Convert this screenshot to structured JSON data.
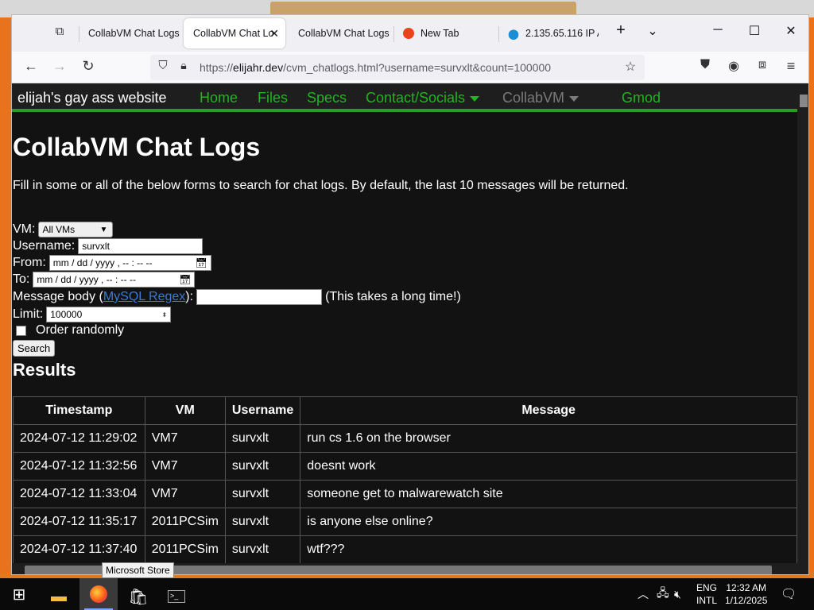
{
  "browser": {
    "tabs": [
      {
        "label": "CollabVM Chat Logs"
      },
      {
        "label": "CollabVM Chat Lo",
        "active": true
      },
      {
        "label": "CollabVM Chat Logs"
      },
      {
        "label": "New Tab"
      },
      {
        "label": "2.135.65.116 IP A"
      }
    ],
    "url_prefix": "https://",
    "url_domain": "elijahr.dev",
    "url_path": "/cvm_chatlogs.html?username=survxlt&count=100000"
  },
  "site": {
    "brand": "elijah's gay ass website",
    "nav": [
      "Home",
      "Files",
      "Specs",
      "Contact/Socials",
      "CollabVM",
      "Gmod"
    ],
    "accent": "#22b422"
  },
  "page": {
    "title": "CollabVM Chat Logs",
    "intro": "Fill in some or all of the below forms to search for chat logs. By default, the last 10 messages will be returned.",
    "vm_label": "VM:",
    "vm_selected": "All VMs",
    "username_label": "Username:",
    "username_value": "survxlt",
    "from_label": "From:",
    "to_label": "To:",
    "datetime_placeholder": "mm / dd / yyyy ,  -- : --   --",
    "msg_label_start": "Message body (",
    "msg_link": "MySQL Regex",
    "msg_label_end": "):",
    "msg_note": "(This takes a long time!)",
    "limit_label": "Limit:",
    "limit_value": "100000",
    "random_label": "Order randomly",
    "search_button": "Search",
    "results_heading": "Results"
  },
  "table": {
    "headers": [
      "Timestamp",
      "VM",
      "Username",
      "Message"
    ],
    "rows": [
      [
        "2024-07-12 11:29:02",
        "VM7",
        "survxlt",
        "run cs 1.6 on the browser"
      ],
      [
        "2024-07-12 11:32:56",
        "VM7",
        "survxlt",
        "doesnt work"
      ],
      [
        "2024-07-12 11:33:04",
        "VM7",
        "survxlt",
        "someone get to malwarewatch site"
      ],
      [
        "2024-07-12 11:35:17",
        "2011PCSim",
        "survxlt",
        "is anyone else online?"
      ],
      [
        "2024-07-12 11:37:40",
        "2011PCSim",
        "survxlt",
        "wtf???"
      ]
    ]
  },
  "taskbar": {
    "tooltip": "Microsoft Store",
    "lang_top": "ENG",
    "lang_bottom": "INTL",
    "time": "12:32 AM",
    "date": "1/12/2025"
  }
}
